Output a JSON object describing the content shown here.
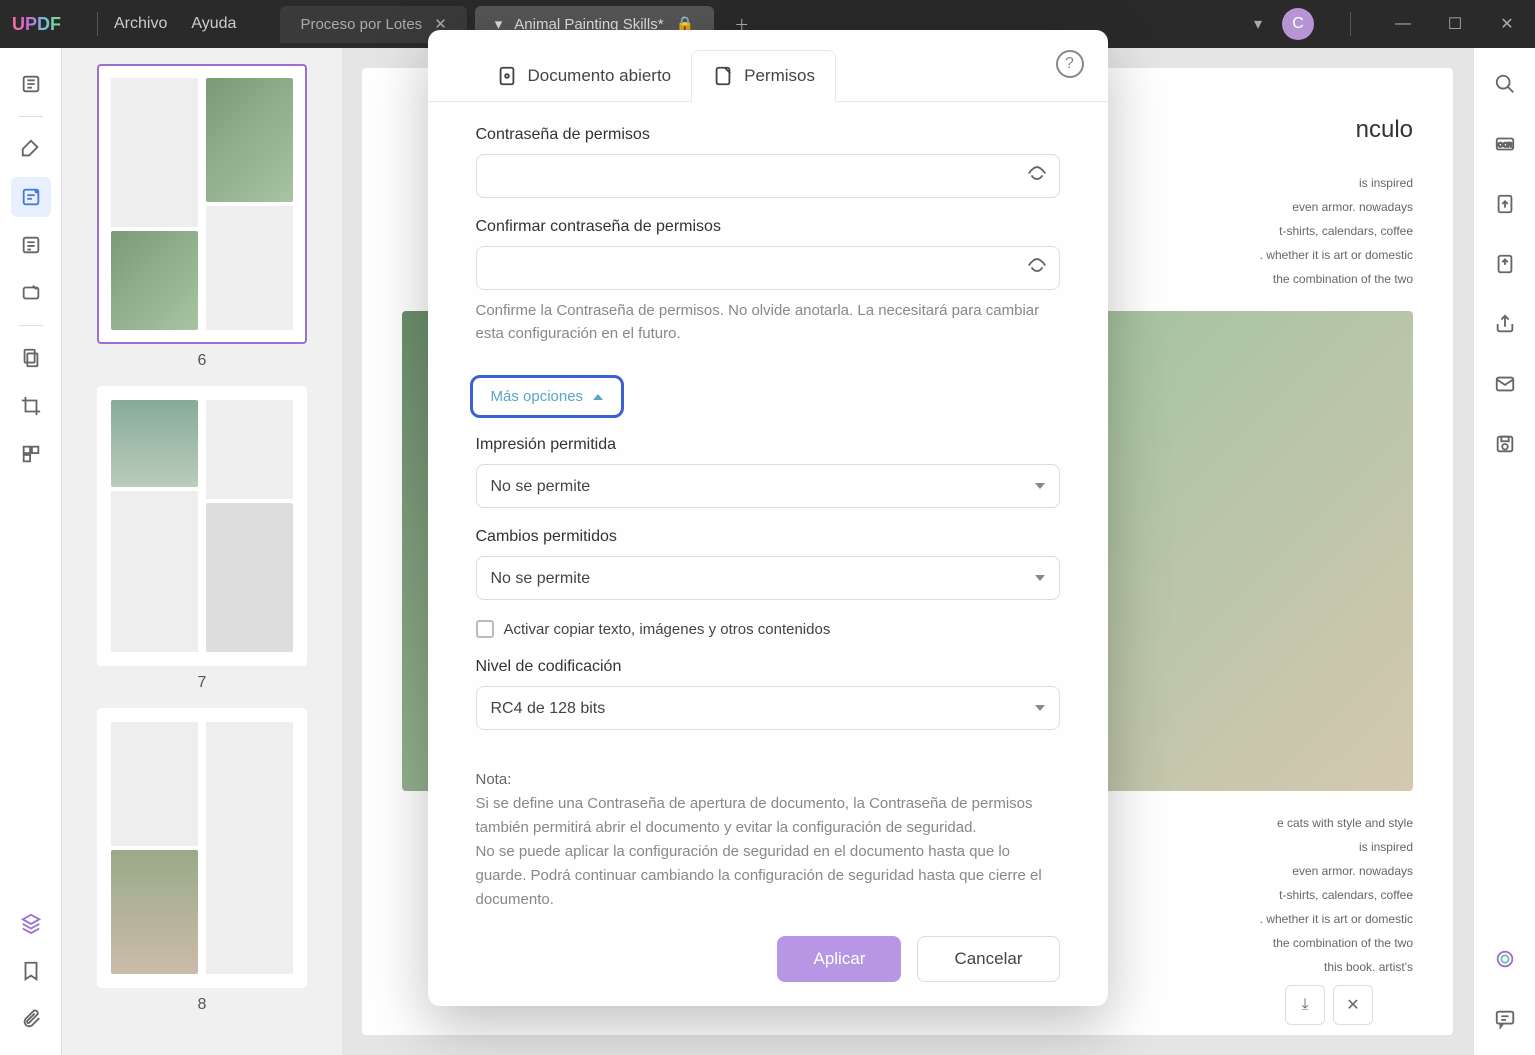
{
  "app": {
    "logo": "UPDF",
    "menu": {
      "file": "Archivo",
      "help": "Ayuda"
    },
    "avatar_letter": "C"
  },
  "tabs": [
    {
      "label": "Proceso por Lotes",
      "active": false
    },
    {
      "label": "Animal Painting Skills*",
      "active": true,
      "locked": true
    }
  ],
  "thumbnails": [
    {
      "page": "6",
      "selected": true
    },
    {
      "page": "7",
      "selected": false
    },
    {
      "page": "8",
      "selected": false
    }
  ],
  "document": {
    "heading_fragment": "nculo",
    "body_lines": [
      "is inspired",
      "even armor. nowadays",
      "t-shirts, calendars, coffee",
      ". whether it is art or domestic",
      "the combination of the two",
      "e cats with style and style",
      "is inspired",
      "even armor. nowadays",
      "t-shirts, calendars, coffee",
      ". whether it is art or domestic",
      "the combination of the two",
      "this book. artist's"
    ]
  },
  "modal": {
    "help_tooltip": "?",
    "tab_open_doc": "Documento abierto",
    "tab_permissions": "Permisos",
    "password_label": "Contraseña de permisos",
    "confirm_label": "Confirmar contraseña de permisos",
    "confirm_hint": "Confirme la Contraseña de permisos. No olvide anotarla. La necesitará para cambiar esta configuración en el futuro.",
    "more_options": "Más opciones",
    "printing_label": "Impresión permitida",
    "printing_value": "No se permite",
    "changes_label": "Cambios permitidos",
    "changes_value": "No se permite",
    "copy_checkbox": "Activar copiar texto, imágenes y otros contenidos",
    "encryption_label": "Nivel de codificación",
    "encryption_value": "RC4 de 128 bits",
    "note_title": "Nota:",
    "note_line1": "Si se define una Contraseña de apertura de documento, la Contraseña de permisos también permitirá abrir el documento  y evitar la configuración de seguridad.",
    "note_line2": "No se puede aplicar la configuración de seguridad en el documento hasta que lo guarde. Podrá continuar cambiando la configuración de seguridad hasta que cierre el documento.",
    "apply": "Aplicar",
    "cancel": "Cancelar"
  }
}
